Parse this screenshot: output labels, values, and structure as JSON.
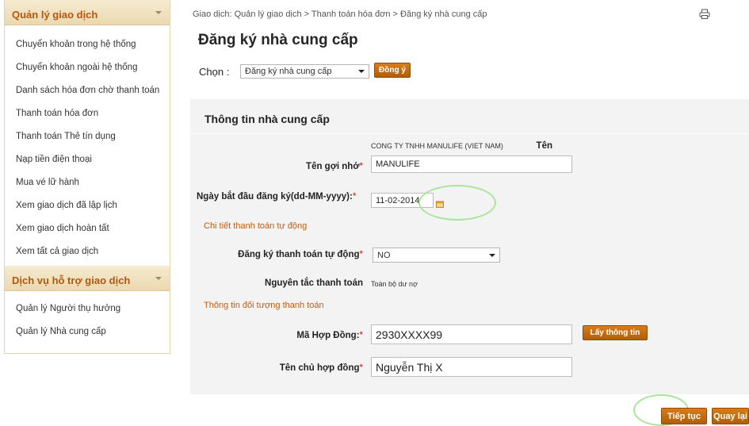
{
  "sidebar": {
    "group1": {
      "title": "Quản lý giao dịch",
      "items": [
        {
          "label": "Chuyển khoản trong hệ thống"
        },
        {
          "label": "Chuyển khoản ngoài hệ thống"
        },
        {
          "label": "Danh sách hóa đơn chờ thanh toán"
        },
        {
          "label": "Thanh toán hóa đơn"
        },
        {
          "label": "Thanh toán Thẻ tín dụng"
        },
        {
          "label": "Nạp tiền điện thoại"
        },
        {
          "label": "Mua vé lữ hành"
        },
        {
          "label": "Xem giao dịch đã lập lịch"
        },
        {
          "label": "Xem giao dịch hoàn tất"
        },
        {
          "label": "Xem tất cả giao dịch"
        }
      ]
    },
    "group2": {
      "title": "Dịch vụ hỗ trợ giao dịch",
      "items": [
        {
          "label": "Quản lý Người thụ hưởng"
        },
        {
          "label": "Quản lý Nhà cung cấp"
        }
      ]
    }
  },
  "breadcrumb": "Giao dịch: Quản lý giao dịch > Thanh toán hóa đơn > Đăng ký nhà cung cấp",
  "icons": {
    "print": "printer-icon",
    "calendar": "calendar-icon",
    "dropdown": "chevron-down-icon"
  },
  "page_title": "Đăng ký nhà cung cấp",
  "chon": {
    "label": "Chọn :",
    "selected": "Đăng ký nhà cung cấp",
    "confirm_button": "Đồng ý"
  },
  "form": {
    "section_title": "Thông tin nhà cung cấp",
    "name_label": "Tên",
    "name_value": "CONG TY TNHH MANULIFE (VIET NAM)",
    "nickname_label": "Tên gợi nhớ",
    "nickname_value": "MANULIFE",
    "start_date_label": "Ngày bắt đầu đăng ký(dd-MM-yyyy):",
    "start_date_value": "11-02-2014",
    "auto_section": "Chi tiết thanh toán tự động",
    "auto_pay_label": "Đăng ký thanh toán tự động",
    "auto_pay_value": "NO",
    "principle_label": "Nguyên tắc thanh toán",
    "principle_value": "Toàn bộ dư nợ",
    "target_section": "Thông tin đối tượng thanh toán",
    "contract_label": "Mã Hợp Đồng:",
    "contract_value": "2930XXXX99",
    "fetch_button": "Lấy thông tin",
    "holder_label": "Tên chủ hợp đồng",
    "holder_value": "Nguyễn Thị X",
    "required_mark": "*"
  },
  "actions": {
    "continue": "Tiếp tục",
    "back": "Quay lại"
  },
  "colors": {
    "accent": "#c45b0c",
    "button": "#c46a10",
    "highlight_circle": "#a8e59a",
    "panel_bg": "#f3f3f3"
  }
}
